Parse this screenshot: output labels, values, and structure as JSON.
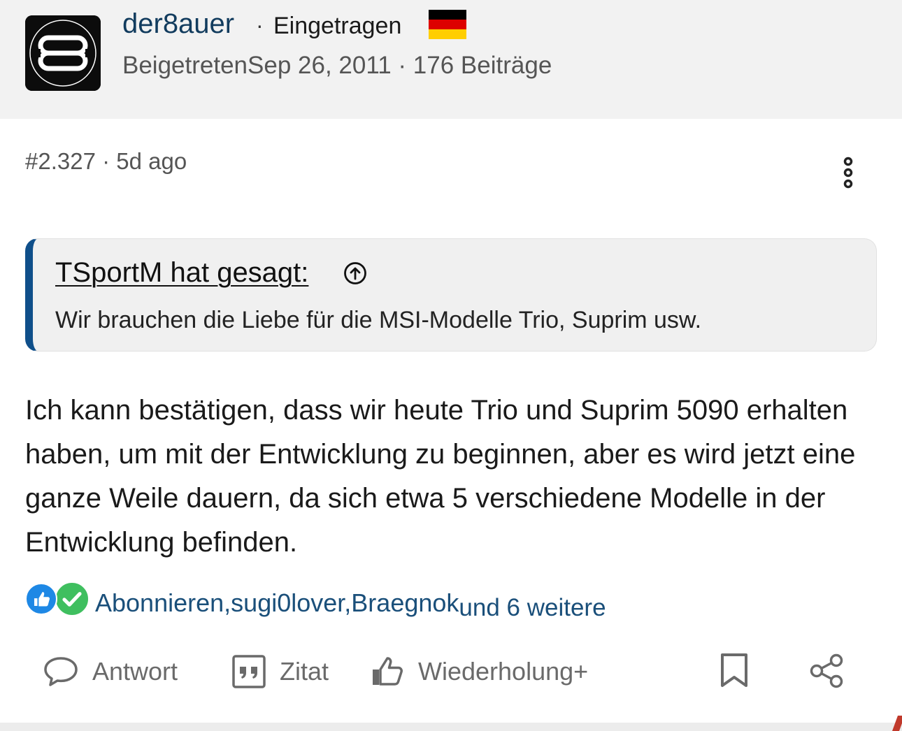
{
  "user": {
    "name": "der8auer",
    "separator": "·",
    "rank": "Eingetragen",
    "country_flag": "germany-flag-icon",
    "joined_label": "Beigetreten",
    "joined_date": "Sep 26, 2011",
    "meta_separator": " · ",
    "post_count": "176 Beiträge"
  },
  "post": {
    "number": "#2.327",
    "separator": " · ",
    "age": "5d ago",
    "menu_icon": "more-vertical-icon",
    "quote": {
      "author_text": "TSportM hat gesagt:",
      "jump_icon": "arrow-up-circle-icon",
      "text": "Wir brauchen die Liebe für die MSI-Modelle Trio, Suprim usw.",
      "accent_color": "#0f4f8a"
    },
    "body": "Ich kann bestätigen, dass wir heute Trio und Suprim 5090 erhalten haben, um mit der Entwicklung zu beginnen, aber es wird jetzt eine ganze Weile dauern, da sich etwa 5 verschiedene Modelle in der Entwicklung befinden."
  },
  "reactions": {
    "icons": [
      "thumbs-up-icon",
      "check-icon"
    ],
    "users": [
      "Abonnieren",
      "sugi0lover",
      "Braegnok"
    ],
    "comma": ",",
    "more": "und 6 weitere",
    "link_color": "#1a4f7a"
  },
  "actions": {
    "reply": {
      "label": "Antwort",
      "icon": "speech-bubble-icon"
    },
    "quote": {
      "label": "Zitat",
      "icon": "quote-icon"
    },
    "react": {
      "label": "Wiederholung+",
      "icon": "thumbs-up-outline-icon"
    },
    "bookmark": {
      "icon": "bookmark-icon"
    },
    "share": {
      "icon": "share-icon"
    }
  }
}
